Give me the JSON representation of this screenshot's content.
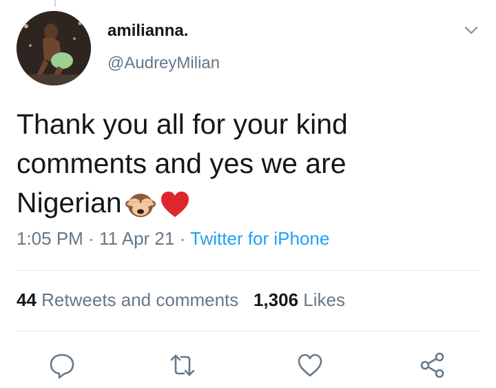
{
  "tweet": {
    "display_name": "amilianna.",
    "handle": "@AudreyMilian",
    "text_line1": "Thank you all for your kind",
    "text_line2": "comments and yes we are",
    "text_line3": "Nigerian",
    "emojis": [
      "see-no-evil-monkey",
      "red-heart"
    ],
    "time": "1:05 PM",
    "date": "11 Apr 21",
    "source": "Twitter for iPhone",
    "separator": "·"
  },
  "stats": {
    "retweets_count": "44",
    "retweets_label": "Retweets and comments",
    "likes_count": "1,306",
    "likes_label": "Likes"
  },
  "actions": {
    "icons": [
      "reply-icon",
      "retweet-icon",
      "like-icon",
      "share-icon"
    ]
  },
  "colors": {
    "text": "#14171a",
    "secondary": "#657786",
    "link": "#1da1f2",
    "divider": "#e1e8ed",
    "heart": "#e0262d"
  }
}
